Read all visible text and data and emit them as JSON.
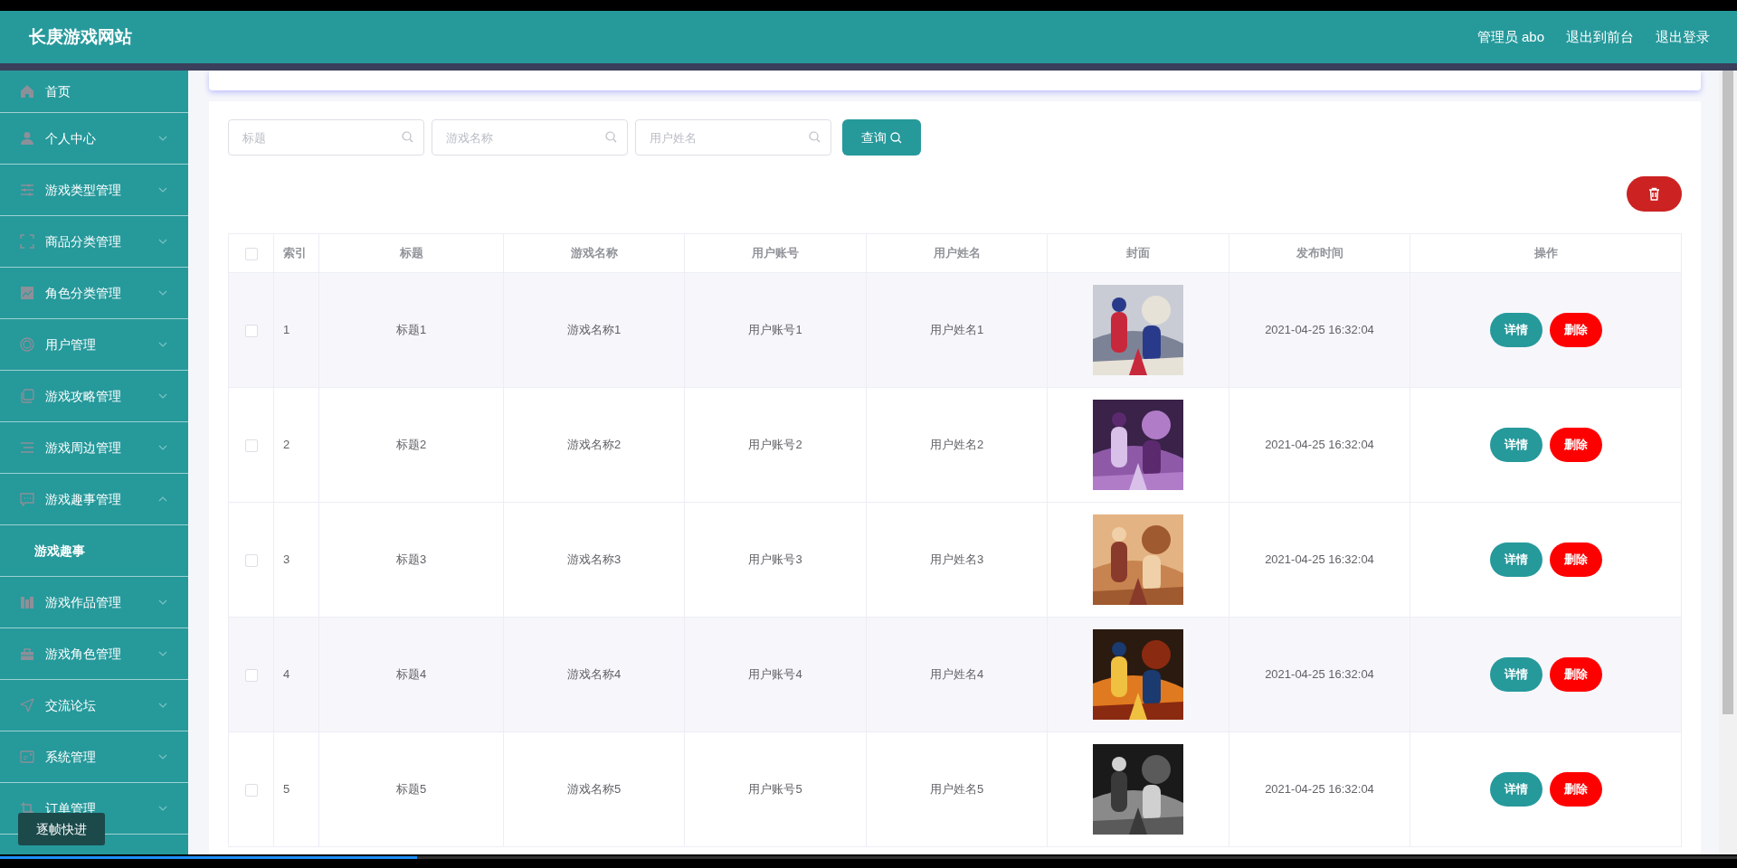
{
  "header": {
    "title": "长庚游戏网站",
    "links": [
      "管理员 abo",
      "退出到前台",
      "退出登录"
    ]
  },
  "sidebar": {
    "items": [
      {
        "label": "首页"
      },
      {
        "label": "个人中心",
        "expanded": false
      },
      {
        "label": "游戏类型管理",
        "expanded": false
      },
      {
        "label": "商品分类管理",
        "expanded": false
      },
      {
        "label": "角色分类管理",
        "expanded": false
      },
      {
        "label": "用户管理",
        "expanded": false
      },
      {
        "label": "游戏攻略管理",
        "expanded": false
      },
      {
        "label": "游戏周边管理",
        "expanded": false
      },
      {
        "label": "游戏趣事管理",
        "expanded": true,
        "children": [
          {
            "label": "游戏趣事"
          }
        ]
      },
      {
        "label": "游戏作品管理",
        "expanded": false
      },
      {
        "label": "游戏角色管理",
        "expanded": false
      },
      {
        "label": "交流论坛",
        "expanded": false
      },
      {
        "label": "系统管理",
        "expanded": false
      },
      {
        "label": "订单管理",
        "expanded": false
      }
    ]
  },
  "search": {
    "fields": [
      {
        "placeholder": "标题"
      },
      {
        "placeholder": "游戏名称"
      },
      {
        "placeholder": "用户姓名"
      }
    ],
    "button": "查询"
  },
  "table": {
    "all_selected": false,
    "columns": [
      "索引",
      "标题",
      "游戏名称",
      "用户账号",
      "用户姓名",
      "封面",
      "发布时间",
      "操作"
    ],
    "rows": [
      {
        "selected": false,
        "cells": [
          "1",
          "标题1",
          "游戏名称1",
          "用户账号1",
          "用户姓名1"
        ],
        "time": "2021-04-25 16:32:04",
        "actions": [
          "详情",
          "删除"
        ]
      },
      {
        "selected": false,
        "cells": [
          "2",
          "标题2",
          "游戏名称2",
          "用户账号2",
          "用户姓名2"
        ],
        "time": "2021-04-25 16:32:04",
        "actions": [
          "详情",
          "删除"
        ]
      },
      {
        "selected": false,
        "cells": [
          "3",
          "标题3",
          "游戏名称3",
          "用户账号3",
          "用户姓名3"
        ],
        "time": "2021-04-25 16:32:04",
        "actions": [
          "详情",
          "删除"
        ]
      },
      {
        "selected": false,
        "cells": [
          "4",
          "标题4",
          "游戏名称4",
          "用户账号4",
          "用户姓名4"
        ],
        "time": "2021-04-25 16:32:04",
        "actions": [
          "详情",
          "删除"
        ]
      },
      {
        "selected": false,
        "cells": [
          "5",
          "标题5",
          "游戏名称5",
          "用户账号5",
          "用户姓名5"
        ],
        "time": "2021-04-25 16:32:04",
        "actions": [
          "详情",
          "删除"
        ]
      }
    ]
  },
  "tooltip": {
    "text": "逐帧快进"
  },
  "video_progress": {
    "level": 0.24
  }
}
